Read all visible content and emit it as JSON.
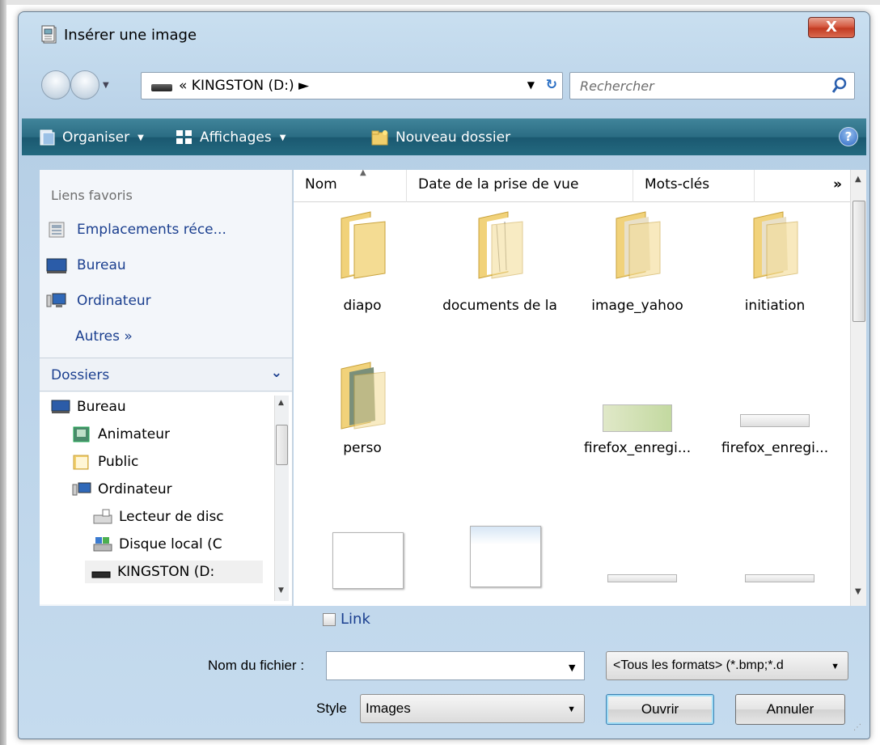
{
  "window": {
    "title": "Insérer une image",
    "close_label": "X"
  },
  "nav": {
    "address_text": "« KINGSTON (D:) ►",
    "search_placeholder": "Rechercher"
  },
  "toolbar": {
    "organiser": "Organiser",
    "affichages": "Affichages",
    "nouveau_dossier": "Nouveau dossier",
    "help": "?"
  },
  "favorites": {
    "title": "Liens favoris",
    "items": [
      {
        "label": "Emplacements réce...",
        "icon": "recent-places-icon"
      },
      {
        "label": "Bureau",
        "icon": "desktop-icon"
      },
      {
        "label": "Ordinateur",
        "icon": "computer-icon"
      }
    ],
    "more": "Autres »"
  },
  "folders_panel": {
    "title": "Dossiers",
    "tree": [
      {
        "label": "Bureau",
        "icon": "desktop-icon"
      },
      {
        "label": "Animateur",
        "icon": "user-folder-icon"
      },
      {
        "label": "Public",
        "icon": "folder-icon"
      },
      {
        "label": "Ordinateur",
        "icon": "computer-icon"
      },
      {
        "label": "Lecteur de disc",
        "icon": "floppy-drive-icon"
      },
      {
        "label": "Disque local (C",
        "icon": "local-disk-icon"
      },
      {
        "label": "KINGSTON (D:",
        "icon": "usb-drive-icon"
      }
    ]
  },
  "columns": {
    "nom": "Nom",
    "date": "Date de la prise de vue",
    "mots": "Mots-clés",
    "more": "»"
  },
  "files": [
    {
      "label": "diapo",
      "kind": "folder"
    },
    {
      "label": "documents de la",
      "kind": "folder"
    },
    {
      "label": "image_yahoo",
      "kind": "folder"
    },
    {
      "label": "initiation",
      "kind": "folder"
    },
    {
      "label": "perso",
      "kind": "folder"
    },
    {
      "label": "firefox_enregi...",
      "kind": "image"
    },
    {
      "label": "firefox_enregi...",
      "kind": "image"
    }
  ],
  "footer": {
    "link_label": "Link",
    "filename_label": "Nom du fichier :",
    "filename_value": "",
    "formats_value": "<Tous les formats> (*.bmp;*.d",
    "style_label": "Style",
    "style_value": "Images",
    "open_button": "Ouvrir",
    "cancel_button": "Annuler"
  },
  "colors": {
    "toolbar": "#2a6c83",
    "link_blue": "#1b3f8f",
    "close_red": "#c23b22",
    "folder_yellow": "#f1d27a"
  }
}
